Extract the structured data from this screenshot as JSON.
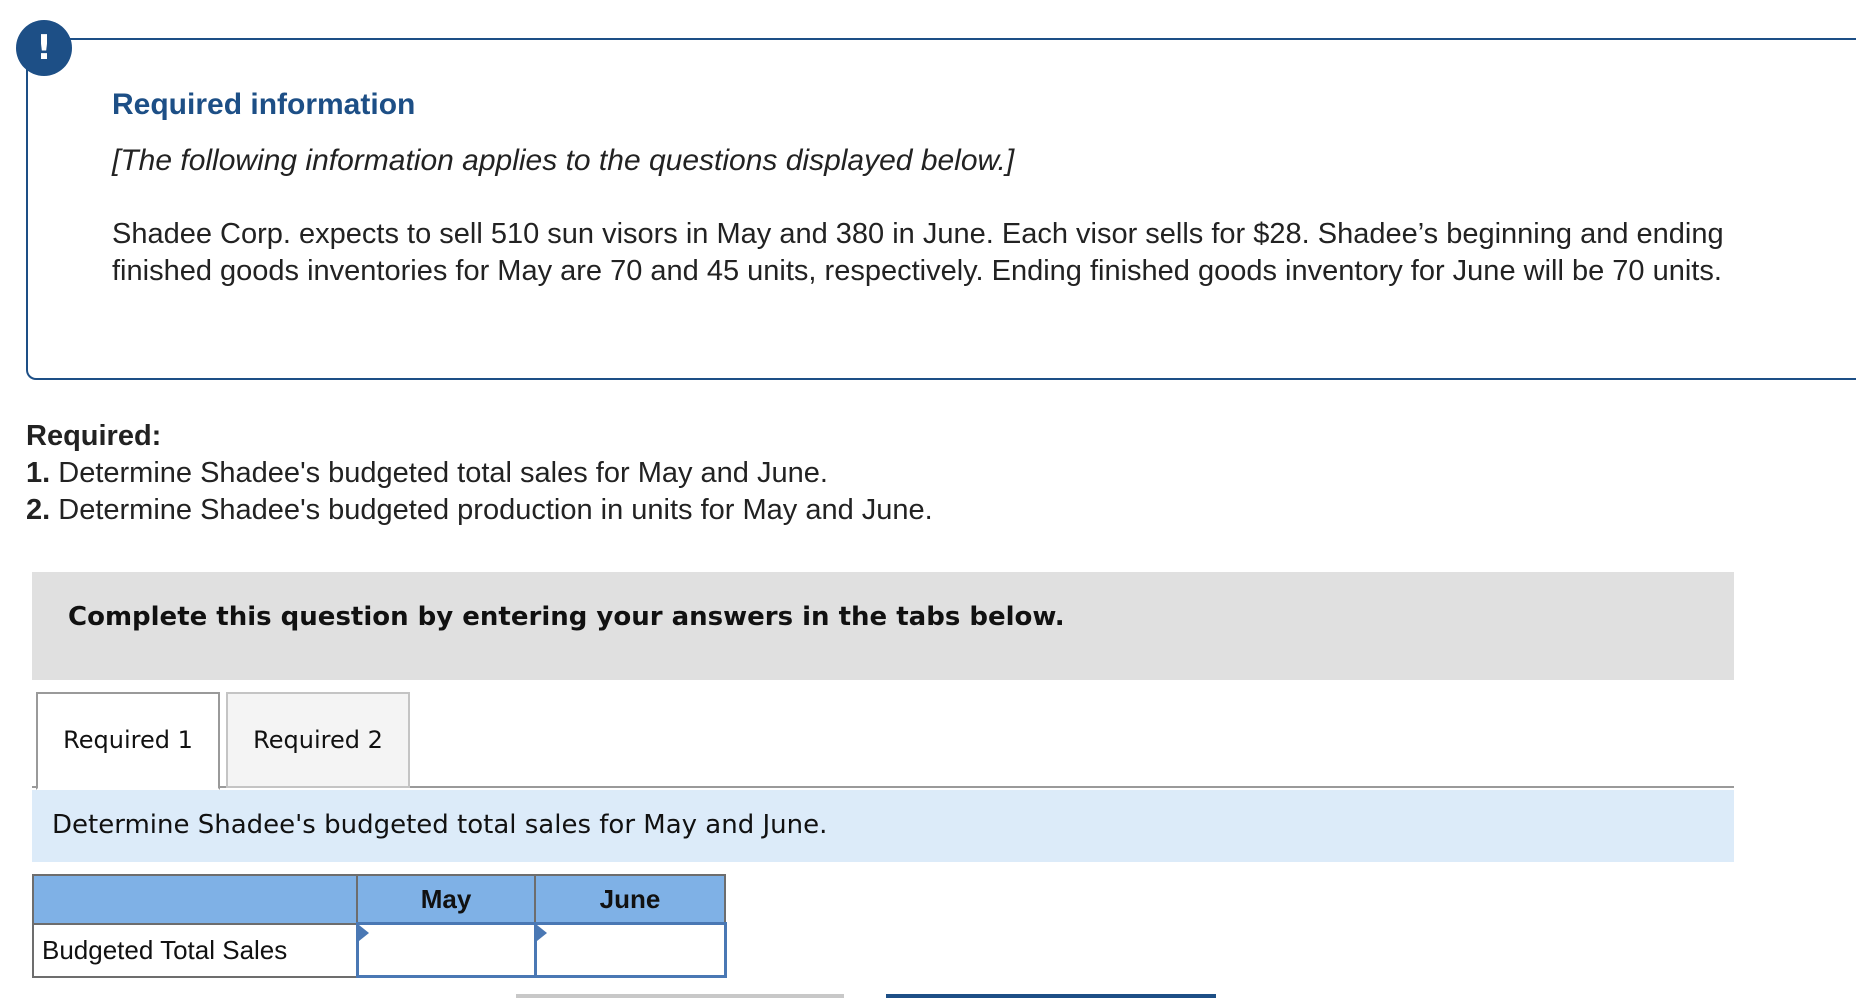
{
  "info_box": {
    "alert_symbol": "!",
    "title": "Required information",
    "note": "[The following information applies to the questions displayed below.]",
    "body": "Shadee Corp. expects to sell 510 sun visors in May and 380 in June. Each visor sells for $28. Shadee’s beginning and ending finished goods inventories for May are 70 and 45 units, respectively. Ending finished goods inventory for June will be 70 units."
  },
  "required": {
    "heading": "Required:",
    "items": [
      {
        "num": "1.",
        "text": "Determine Shadee's budgeted total sales for May and June."
      },
      {
        "num": "2.",
        "text": "Determine Shadee's budgeted production in units for May and June."
      }
    ]
  },
  "instruction": "Complete this question by entering your answers in the tabs below.",
  "tabs": [
    {
      "label": "Required 1",
      "active": true
    },
    {
      "label": "Required 2",
      "active": false
    }
  ],
  "prompt": "Determine Shadee's budgeted total sales for May and June.",
  "table": {
    "columns": [
      "",
      "May",
      "June"
    ],
    "rows": [
      {
        "label": "Budgeted Total Sales",
        "may": "",
        "june": ""
      }
    ]
  },
  "colors": {
    "brand_blue": "#1d4f86",
    "header_blue": "#7fb1e6",
    "prompt_bg": "#dcebf9",
    "banner_gray": "#e0e0e0"
  }
}
